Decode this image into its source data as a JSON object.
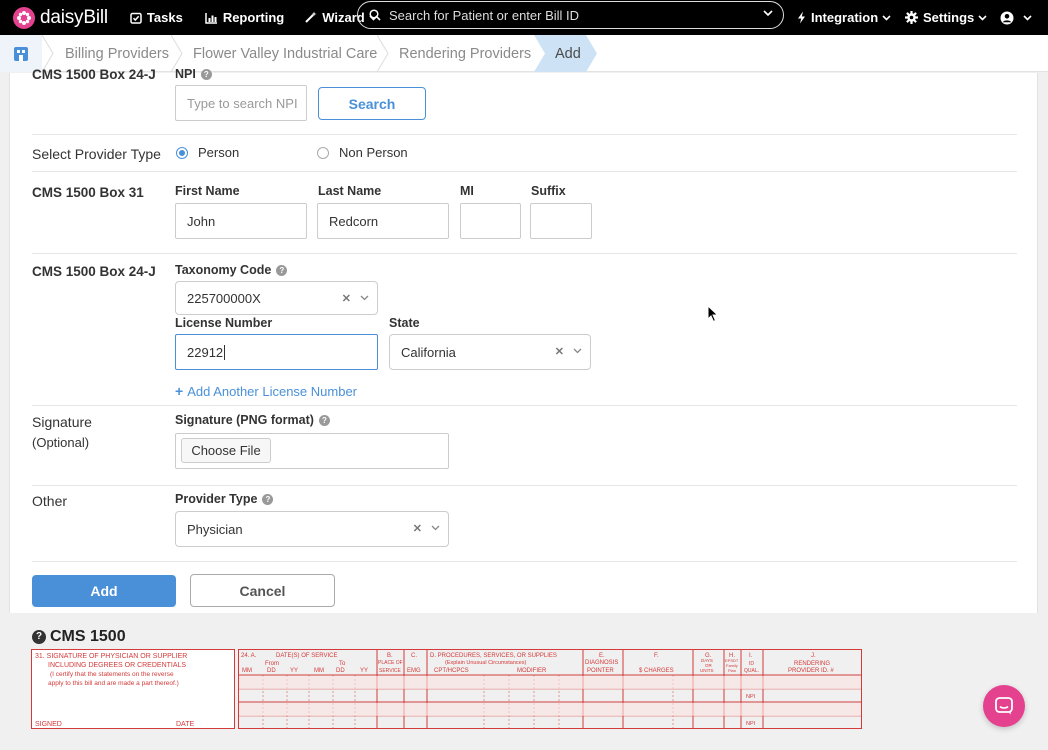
{
  "nav": {
    "brand": "daisyBill",
    "tasks": "Tasks",
    "reporting": "Reporting",
    "wizard": "Wizard",
    "search_placeholder": "Search for Patient or enter Bill ID",
    "integration": "Integration",
    "settings": "Settings"
  },
  "breadcrumb": [
    "Billing Providers",
    "Flower Valley Industrial Care",
    "Rendering Providers",
    "Add"
  ],
  "form": {
    "npi_section": "CMS 1500 Box 24-J",
    "npi_label": "NPI",
    "npi_placeholder": "Type to search NPI",
    "search_button": "Search",
    "provider_type_section": "Select Provider Type",
    "radio_person": "Person",
    "radio_non_person": "Non Person",
    "box31_section": "CMS 1500 Box 31",
    "first_name_label": "First Name",
    "first_name_value": "John",
    "last_name_label": "Last Name",
    "last_name_value": "Redcorn",
    "mi_label": "MI",
    "mi_value": "",
    "suffix_label": "Suffix",
    "suffix_value": "",
    "taxonomy_section": "CMS 1500 Box 24-J",
    "taxonomy_label": "Taxonomy Code",
    "taxonomy_value": "225700000X",
    "license_label": "License Number",
    "license_value": "22912",
    "state_label": "State",
    "state_value": "California",
    "add_license": "Add Another License Number",
    "signature_section": "Signature",
    "signature_sub": "(Optional)",
    "signature_label": "Signature (PNG format)",
    "choose_file": "Choose File",
    "other_section": "Other",
    "provider_type_label": "Provider Type",
    "provider_type_value": "Physician",
    "add_button": "Add",
    "cancel_button": "Cancel"
  },
  "cms": {
    "title": "CMS 1500",
    "box31_title_1": "31. SIGNATURE OF PHYSICIAN OR SUPPLIER",
    "box31_title_2": "INCLUDING DEGREES OR CREDENTIALS",
    "box31_note_1": "(I certify that the statements on the reverse",
    "box31_note_2": "apply to this bill and are made a part thereof.)",
    "signed": "SIGNED",
    "date": "DATE",
    "h24a": "24. A.",
    "h_dates": "DATE(S) OF SERVICE",
    "h_from": "From",
    "h_to": "To",
    "h_mm": "MM",
    "h_dd": "DD",
    "h_yy": "YY",
    "h_b": "B.",
    "h_place": "PLACE OF",
    "h_service": "SERVICE",
    "h_c": "C.",
    "h_emg": "EMG",
    "h_d": "D. PROCEDURES, SERVICES, OR SUPPLIES",
    "h_d_sub": "(Explain Unusual Circumstances)",
    "h_cpt": "CPT/HCPCS",
    "h_modifier": "MODIFIER",
    "h_e": "E.",
    "h_diag": "DIAGNOSIS",
    "h_pointer": "POINTER",
    "h_f": "F.",
    "h_charges": "$ CHARGES",
    "h_g": "G.",
    "h_days": "DAYS",
    "h_or": "OR",
    "h_units": "UNITS",
    "h_h": "H.",
    "h_epsdt": "EPSDT",
    "h_family": "Family",
    "h_plan": "Plan",
    "h_i": "I.",
    "h_id": "ID",
    "h_qual": "QUAL.",
    "h_j": "J.",
    "h_rendering": "RENDERING",
    "h_provider_id": "PROVIDER ID. #",
    "npi_1": "NPI",
    "npi_2": "NPI"
  },
  "colors": {
    "accent": "#4a90d9",
    "brand": "#e4418f",
    "form_red": "#d43a3a"
  }
}
